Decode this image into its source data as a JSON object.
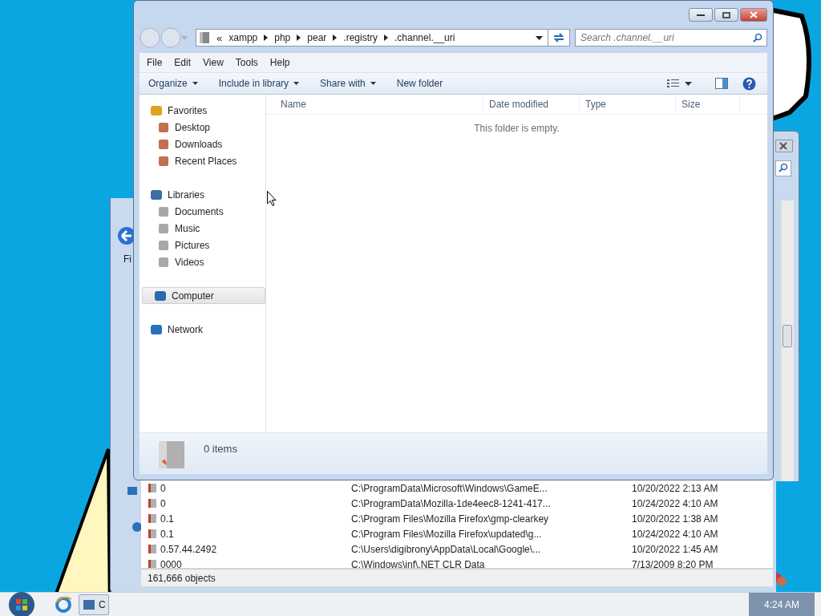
{
  "back_window": {
    "menu_partial": "Fi",
    "rows": [
      {
        "column_1": "0",
        "column_2": "C:\\ProgramData\\Microsoft\\Windows\\GameE...",
        "column_3": "10/20/2022 2:13 AM"
      },
      {
        "column_1": "0",
        "column_2": "C:\\ProgramData\\Mozilla-1de4eec8-1241-417...",
        "column_3": "10/24/2022 4:10 AM"
      },
      {
        "column_1": "0.1",
        "column_2": "C:\\Program Files\\Mozilla Firefox\\gmp-clearkey",
        "column_3": "10/20/2022 1:38 AM"
      },
      {
        "column_1": "0.1",
        "column_2": "C:\\Program Files\\Mozilla Firefox\\updated\\g...",
        "column_3": "10/24/2022 4:10 AM"
      },
      {
        "column_1": "0.57.44.2492",
        "column_2": "C:\\Users\\digibrony\\AppData\\Local\\Google\\...",
        "column_3": "10/20/2022 1:45 AM"
      },
      {
        "column_1": "0000",
        "column_2": "C:\\Windows\\inf\\.NET CLR Data",
        "column_3": "7/13/2009 8:20 PM"
      }
    ],
    "status_bar": "161,666 objects"
  },
  "window": {
    "breadcrumb_overflow": "«",
    "breadcrumbs": [
      "xampp",
      "php",
      "pear",
      ".registry",
      ".channel.__uri"
    ],
    "search": {
      "placeholder": "Search .channel.__uri"
    },
    "menu": [
      "File",
      "Edit",
      "View",
      "Tools",
      "Help"
    ],
    "toolbar": [
      {
        "label": "Organize",
        "dropdown": true
      },
      {
        "label": "Include in library",
        "dropdown": true
      },
      {
        "label": "Share with",
        "dropdown": true
      },
      {
        "label": "New folder",
        "dropdown": false
      }
    ],
    "nav": [
      {
        "label": "Favorites",
        "selected": false,
        "children": [
          {
            "label": "Desktop",
            "selected": false
          },
          {
            "label": "Downloads",
            "selected": false
          },
          {
            "label": "Recent Places",
            "selected": false
          }
        ]
      },
      {
        "label": "Libraries",
        "selected": false,
        "children": [
          {
            "label": "Documents",
            "selected": false
          },
          {
            "label": "Music",
            "selected": false
          },
          {
            "label": "Pictures",
            "selected": false
          },
          {
            "label": "Videos",
            "selected": false
          }
        ]
      },
      {
        "label": "Computer",
        "selected": true
      },
      {
        "label": "Network",
        "selected": false
      }
    ],
    "columns": [
      "Name",
      "Date modified",
      "Type",
      "Size"
    ],
    "empty_message": "This folder is empty.",
    "details": "0 items"
  },
  "taskbar": {
    "button_label": "C",
    "clock": "4:24 AM"
  }
}
